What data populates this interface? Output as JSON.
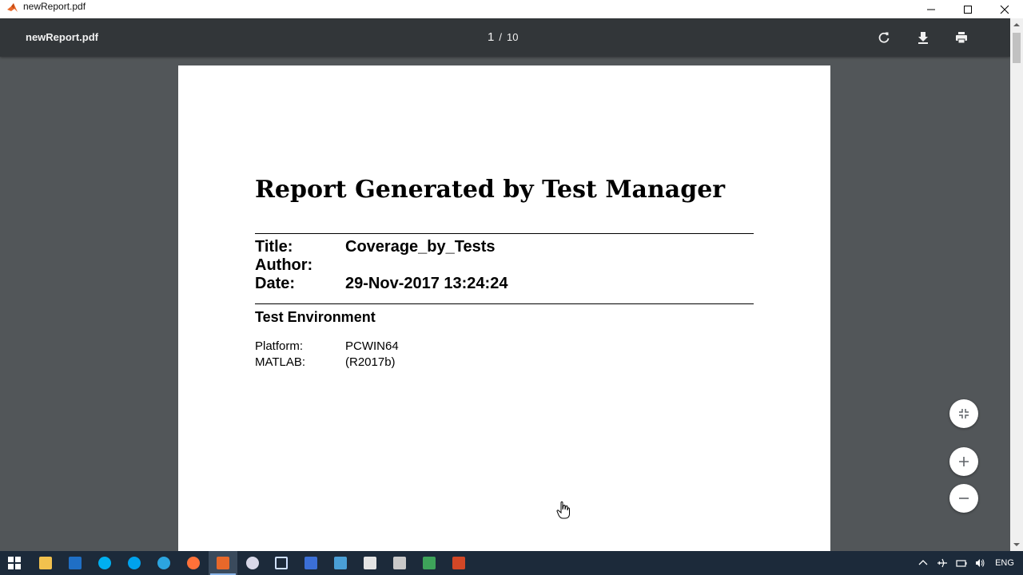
{
  "window": {
    "title": "newReport.pdf",
    "icons": [
      "matlab-icon",
      "minimize-icon",
      "maximize-icon",
      "close-icon"
    ]
  },
  "toolbar": {
    "doc_title": "newReport.pdf",
    "page_current": "1",
    "page_separator": "/",
    "page_total": "10",
    "buttons": [
      "rotate-icon",
      "download-icon",
      "print-icon"
    ]
  },
  "document": {
    "heading": "Report Generated by Test Manager",
    "meta": [
      {
        "label": "Title:",
        "value": "Coverage_by_Tests"
      },
      {
        "label": "Author:",
        "value": ""
      },
      {
        "label": "Date:",
        "value": "29-Nov-2017 13:24:24"
      }
    ],
    "section_heading": "Test Environment",
    "environment": [
      {
        "label": "Platform:",
        "value": "PCWIN64"
      },
      {
        "label": "MATLAB:",
        "value": "(R2017b)"
      }
    ]
  },
  "zoom_controls": [
    "fit-page-icon",
    "zoom-in-icon",
    "zoom-out-icon"
  ],
  "taskbar": {
    "apps": [
      "windows-start-icon",
      "file-explorer-icon",
      "outlook-icon",
      "skype-icon",
      "skype-business-icon",
      "telegram-icon",
      "firefox-icon",
      "matlab-icon",
      "paint-icon",
      "box-icon",
      "save-icon",
      "settings-icon",
      "sync-icon",
      "tool-icon",
      "network-icon",
      "powerpoint-icon"
    ],
    "language": "ENG"
  },
  "colors": {
    "viewer_bg": "#525659",
    "toolbar_bg": "#323639",
    "taskbar_bg": "#1c2a3a"
  }
}
